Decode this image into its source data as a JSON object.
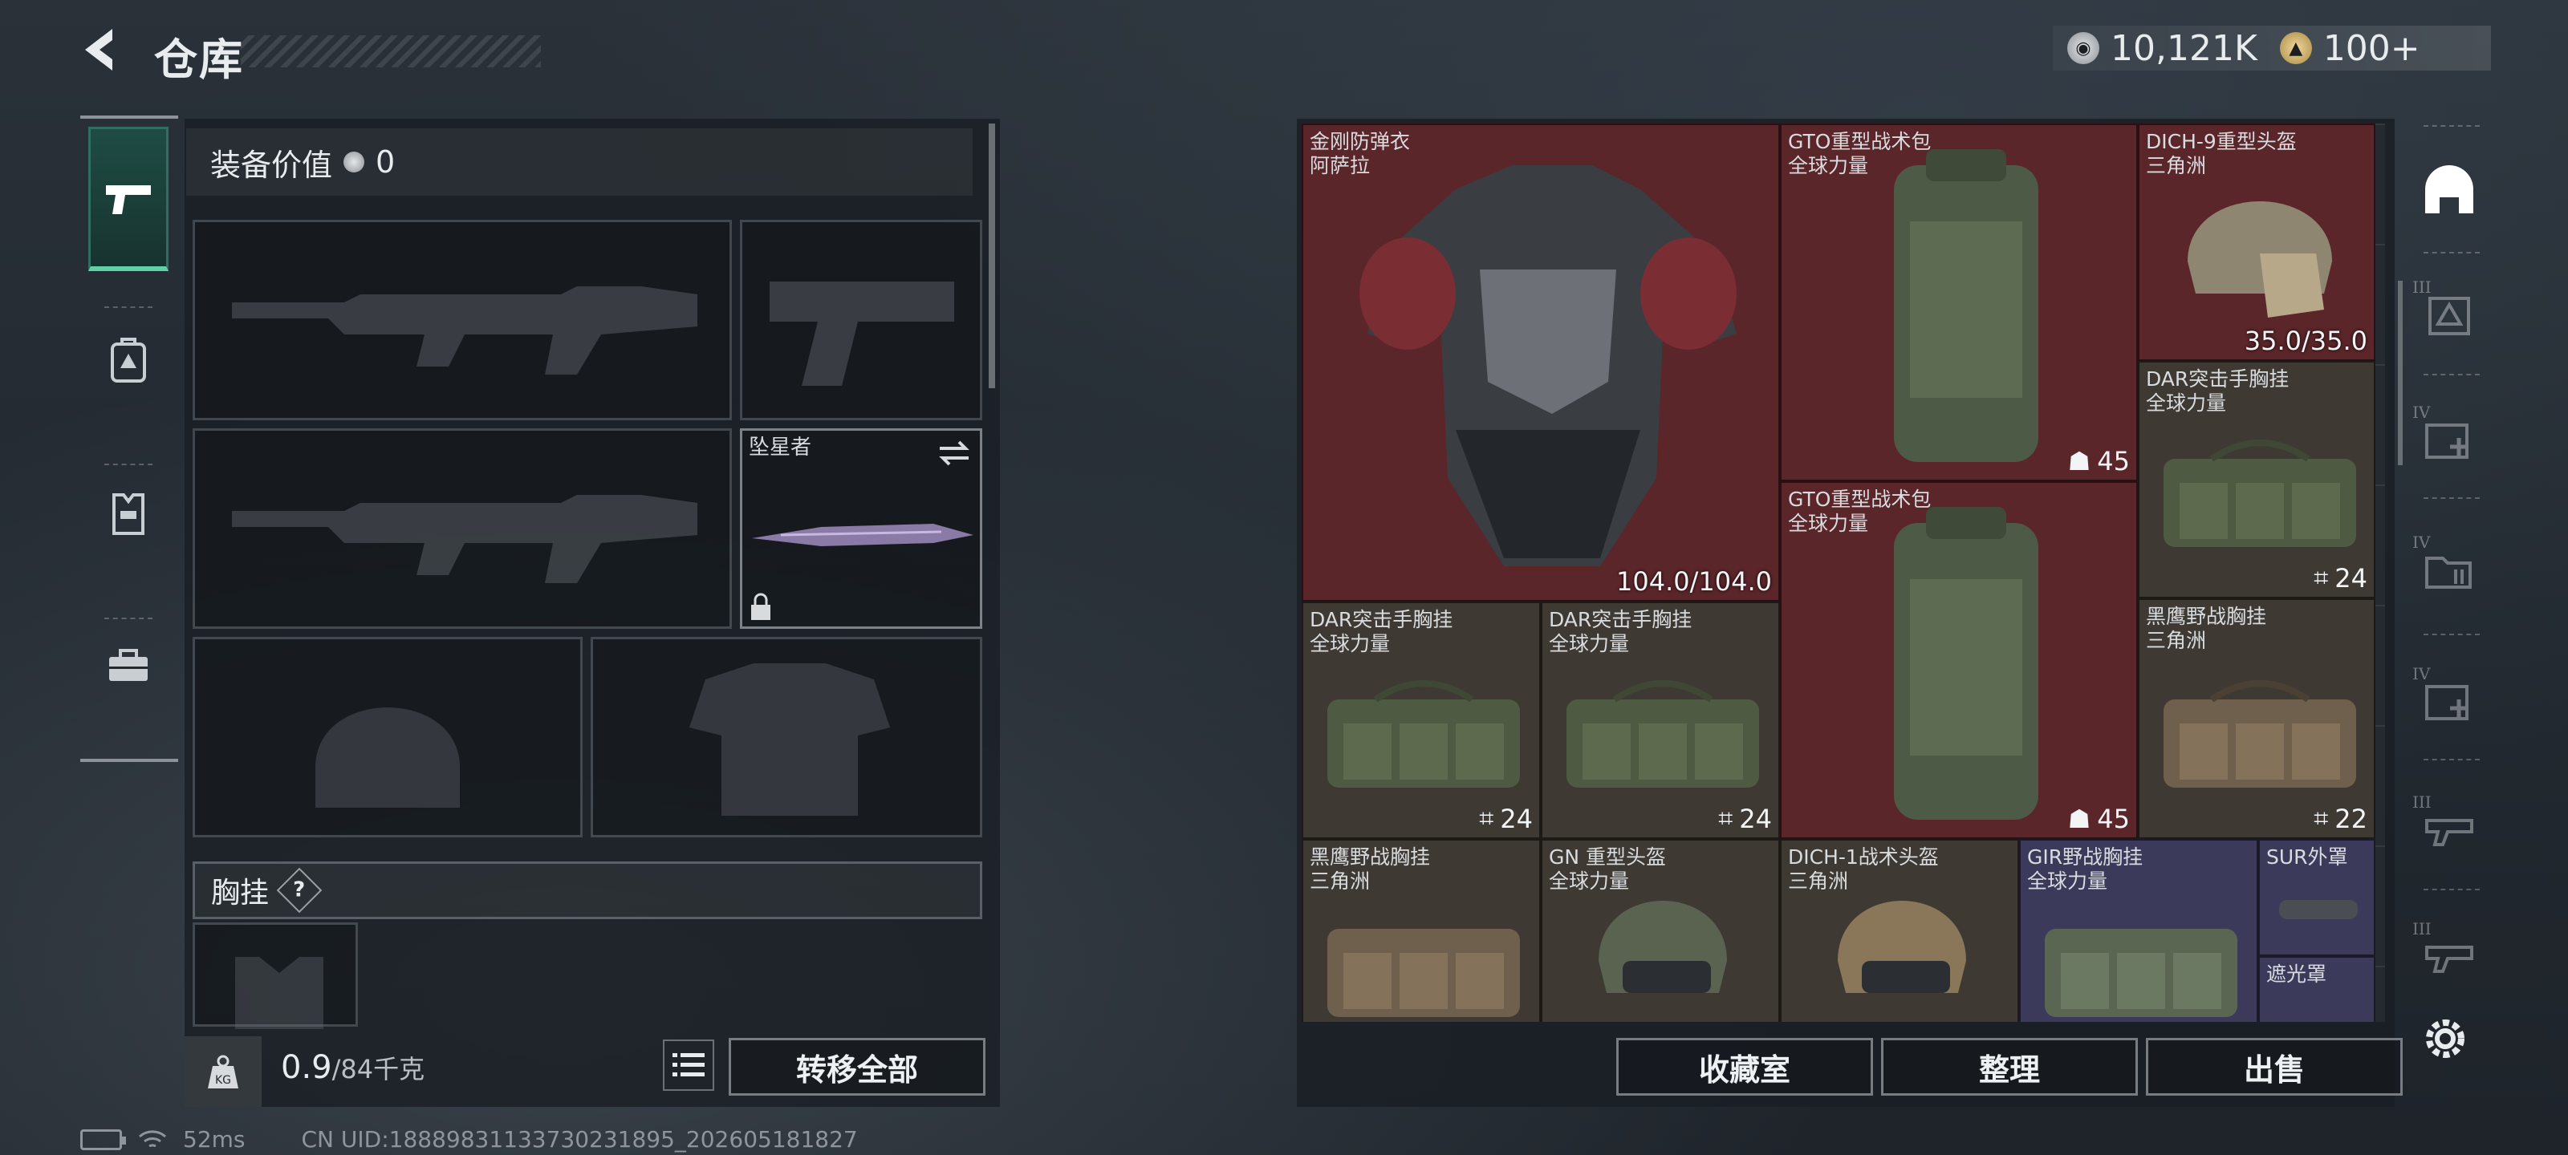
{
  "header": {
    "title": "仓库"
  },
  "currency": {
    "silver": "10,121K",
    "gold": "100+"
  },
  "left_tabs": [
    {
      "name": "weapons-tab",
      "icon": "pistol-icon",
      "active": true
    },
    {
      "name": "armor-tab",
      "icon": "backpack-icon",
      "active": false
    },
    {
      "name": "vest-tab",
      "icon": "vest-icon",
      "active": false
    },
    {
      "name": "toolbox-tab",
      "icon": "toolbox-icon",
      "active": false
    }
  ],
  "equipment": {
    "value_label": "装备价值",
    "value": "0",
    "melee": {
      "name": "坠星者"
    },
    "chest_label": "胸挂",
    "help_mark": "?"
  },
  "footer_left": {
    "weight_icon": "KG",
    "weight_current": "0.9",
    "weight_max": "/84千克",
    "transfer_all": "转移全部"
  },
  "status": {
    "ping": "52ms",
    "uid": "CN UID:18889831133730231895_202605181827"
  },
  "stash": {
    "items": [
      {
        "name": "金刚防弹衣",
        "sub": "阿萨拉",
        "value": "104.0/104.0",
        "rarity": "red"
      },
      {
        "name": "GTO重型战术包",
        "sub": "全球力量",
        "qty": "45",
        "rarity": "red"
      },
      {
        "name": "DICH-9重型头盔",
        "sub": "三角洲",
        "value": "35.0/35.0",
        "rarity": "red"
      },
      {
        "name": "DAR突击手胸挂",
        "sub": "全球力量",
        "qty": "24",
        "rarity": "brown"
      },
      {
        "name": "GTO重型战术包",
        "sub": "全球力量",
        "qty": "45",
        "rarity": "red"
      },
      {
        "name": "DAR突击手胸挂",
        "sub": "全球力量",
        "qty": "24",
        "rarity": "brown"
      },
      {
        "name": "DAR突击手胸挂",
        "sub": "全球力量",
        "qty": "24",
        "rarity": "brown"
      },
      {
        "name": "黑鹰野战胸挂",
        "sub": "三角洲",
        "qty": "22",
        "rarity": "brown"
      },
      {
        "name": "黑鹰野战胸挂",
        "sub": "三角洲",
        "rarity": "brown"
      },
      {
        "name": "GN 重型头盔",
        "sub": "全球力量",
        "rarity": "brown"
      },
      {
        "name": "DICH-1战术头盔",
        "sub": "三角洲",
        "rarity": "brown"
      },
      {
        "name": "GIR野战胸挂",
        "sub": "全球力量",
        "rarity": "purple"
      },
      {
        "name": "SUR外罩",
        "rarity": "purple"
      },
      {
        "name": "遮光罩",
        "rarity": "purple"
      }
    ]
  },
  "footer_right": {
    "collection": "收藏室",
    "sort": "整理",
    "sell": "出售"
  },
  "right_filters": [
    {
      "icon": "helmet-icon",
      "active": true
    },
    {
      "icon": "armor-filter-icon",
      "roman": "III"
    },
    {
      "icon": "medkit-icon",
      "roman": "IV"
    },
    {
      "icon": "ammo-box-icon",
      "roman": "IV"
    },
    {
      "icon": "medkit-icon",
      "roman": "IV"
    },
    {
      "icon": "gun-part-icon",
      "roman": "III"
    },
    {
      "icon": "gun-part-icon",
      "roman": "III"
    }
  ],
  "colors": {
    "accent_green": "#5fd3a6",
    "rarity_red": "#5b262a",
    "rarity_brown": "#3e3a33",
    "rarity_purple": "#3c3a5a"
  }
}
